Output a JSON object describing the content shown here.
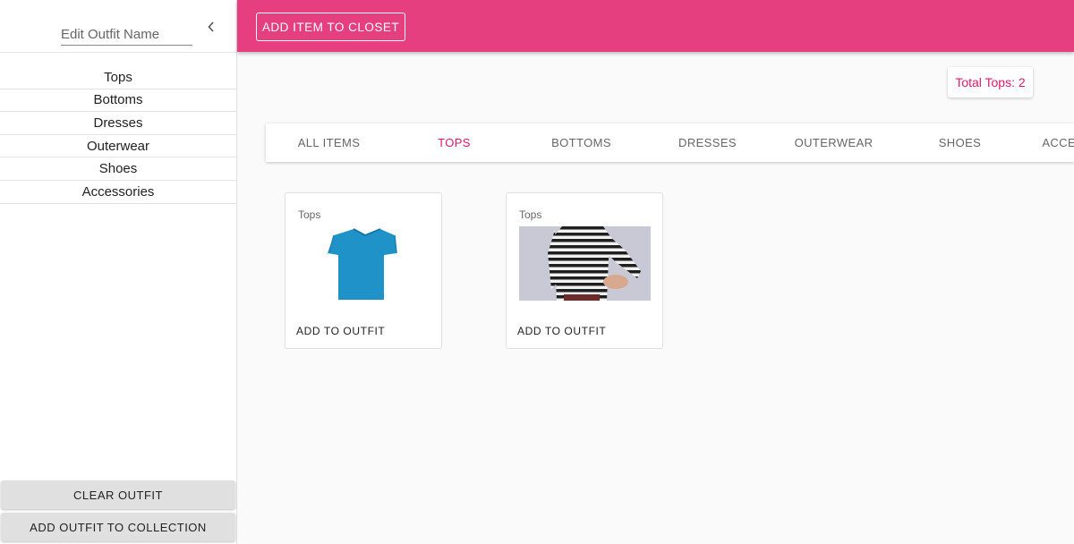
{
  "sidebar": {
    "outfit_name_placeholder": "Edit Outfit Name",
    "outfit_name_value": "",
    "collapse_icon": "chevron-left-icon",
    "categories": [
      "Tops",
      "Bottoms",
      "Dresses",
      "Outerwear",
      "Shoes",
      "Accessories"
    ],
    "clear_label": "CLEAR OUTFIT",
    "add_collection_label": "ADD OUTFIT TO COLLECTION"
  },
  "topbar": {
    "add_item_label": "ADD ITEM TO CLOSET",
    "color": "#e63f7f"
  },
  "total": {
    "label": "Total Tops: 2"
  },
  "tabs": {
    "items": [
      "ALL ITEMS",
      "TOPS",
      "BOTTOMS",
      "DRESSES",
      "OUTERWEAR",
      "SHOES",
      "ACCESSORIES"
    ],
    "active": "TOPS",
    "accent": "#e3176b"
  },
  "cards": [
    {
      "category": "Tops",
      "image": "blue-tshirt",
      "action_label": "ADD TO OUTFIT"
    },
    {
      "category": "Tops",
      "image": "striped-long-sleeve-top",
      "action_label": "ADD TO OUTFIT"
    }
  ]
}
